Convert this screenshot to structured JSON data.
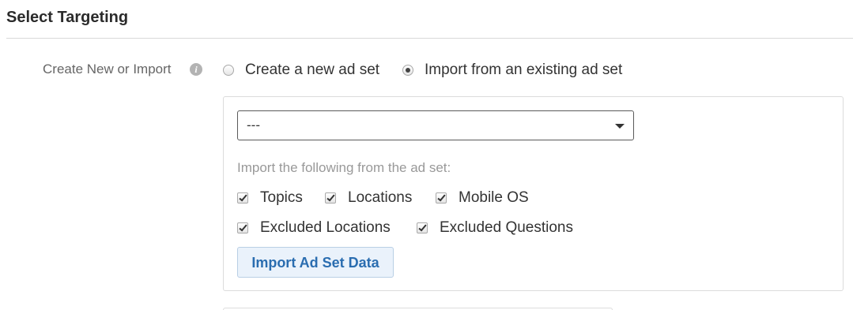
{
  "section": {
    "title": "Select Targeting"
  },
  "mode_row": {
    "label": "Create New or Import",
    "info_icon": "info-icon",
    "options": [
      {
        "label": "Create a new ad set",
        "selected": false
      },
      {
        "label": "Import from an existing ad set",
        "selected": true
      }
    ]
  },
  "import_panel": {
    "select_value": "---",
    "heading": "Import the following from the ad set:",
    "checkboxes": [
      {
        "label": "Topics",
        "checked": true
      },
      {
        "label": "Locations",
        "checked": true
      },
      {
        "label": "Mobile OS",
        "checked": true
      },
      {
        "label": "Excluded Locations",
        "checked": true
      },
      {
        "label": "Excluded Questions",
        "checked": true
      }
    ],
    "button_label": "Import Ad Set Data"
  },
  "colors": {
    "button_text": "#2a6db0",
    "button_bg": "#eaf2fb",
    "muted_text": "#999999"
  }
}
